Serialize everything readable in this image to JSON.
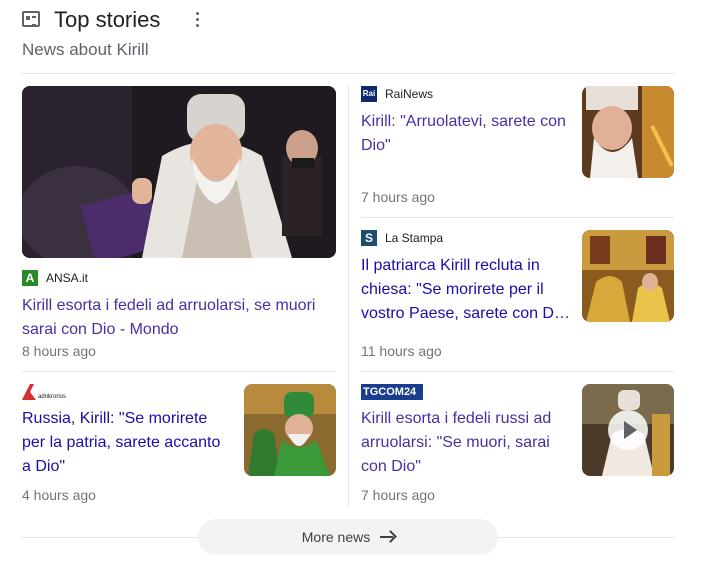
{
  "header": {
    "title": "Top stories",
    "subtitle": "News about Kirill"
  },
  "stories": [
    {
      "source": "ANSA.it",
      "headline": "Kirill esorta i fedeli ad arruolarsi, se muori sarai con Dio - Mondo",
      "time": "8 hours ago",
      "logo": "ansa-logo",
      "logo_text": "A",
      "brand_color": "#2a8a2a"
    },
    {
      "source": "RaiNews",
      "headline": "Kirill: \"Arruolatevi, sarete con Dio\"",
      "time": "7 hours ago",
      "logo": "rainews-logo",
      "logo_text": "Rai",
      "brand_color": "#0b2a6b"
    },
    {
      "source": "La Stampa",
      "headline": "Il patriarca Kirill recluta in chiesa: \"Se morirete per il vostro Paese, sarete con D…",
      "time": "11 hours ago",
      "logo": "lastampa-logo",
      "logo_text": "S",
      "brand_color": "#1d4e72"
    },
    {
      "source": "",
      "headline": "Russia, Kirill: \"Se morirete per la patria, sarete accanto a Dio\"",
      "time": "4 hours ago",
      "logo": "adnkronos-logo",
      "logo_text": "adnkronos",
      "brand_color": "#d32f2f"
    },
    {
      "source": "",
      "headline": "Kirill esorta i fedeli russi ad arruolarsi: \"Se muori, sarai con Dio\"",
      "time": "7 hours ago",
      "logo": "tgcom24-logo",
      "logo_text": "TGCOM24",
      "brand_color": "#1a3d8f"
    }
  ],
  "more_button": {
    "label": "More news"
  },
  "icons": {
    "header": "newspaper-icon",
    "menu": "kebab-menu-icon",
    "play": "play-icon",
    "arrow": "arrow-right-icon"
  }
}
